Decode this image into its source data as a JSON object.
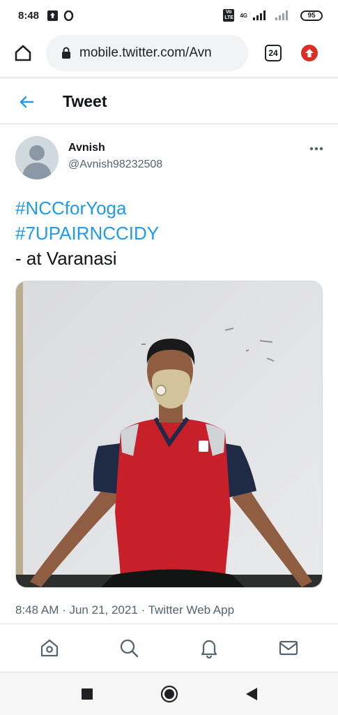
{
  "status_bar": {
    "time": "8:48",
    "network_labels": {
      "volte": "Vo LTE",
      "gen": "4G"
    },
    "battery": "95"
  },
  "browser": {
    "url": "mobile.twitter.com/Avn",
    "tab_count": "24"
  },
  "header": {
    "title": "Tweet"
  },
  "tweet": {
    "display_name": "Avnish",
    "handle": "@Avnish98232508",
    "lines": [
      "#NCCforYoga",
      "#7UPAIRNCCIDY",
      "- at Varanasi"
    ],
    "meta": "8:48 AM · Jun 21, 2021 · Twitter Web App"
  },
  "colors": {
    "accent": "#1d9bf0",
    "shirt": "#c8202a",
    "sleeve": "#1f2a44",
    "mask": "#d2c39b",
    "wall": "#e7e8ea"
  },
  "icons": {
    "status": [
      "upload-icon",
      "opera-icon",
      "signal-icon",
      "wifi-icon",
      "battery-icon"
    ],
    "nav": [
      "home-icon",
      "search-icon",
      "notifications-icon",
      "messages-icon"
    ],
    "system": [
      "recents-icon",
      "home-circle-icon",
      "back-triangle-icon"
    ]
  }
}
